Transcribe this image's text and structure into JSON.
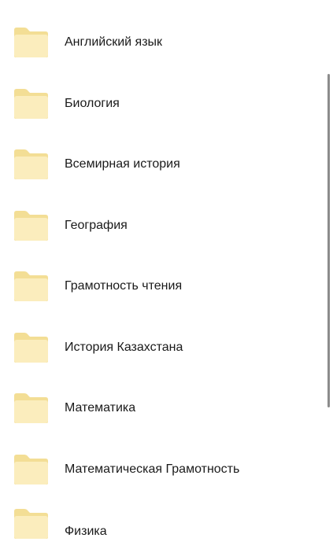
{
  "folders": [
    {
      "name": "Английский язык",
      "icon": "folder-icon"
    },
    {
      "name": "Биология",
      "icon": "folder-icon"
    },
    {
      "name": "Всемирная история",
      "icon": "folder-icon"
    },
    {
      "name": "География",
      "icon": "folder-icon"
    },
    {
      "name": "Грамотность чтения",
      "icon": "folder-icon"
    },
    {
      "name": "История Казахстана",
      "icon": "folder-icon"
    },
    {
      "name": "Математика",
      "icon": "folder-icon"
    },
    {
      "name": "Математическая Грамотность",
      "icon": "folder-icon"
    },
    {
      "name": "Физика",
      "icon": "folder-icon"
    }
  ],
  "colors": {
    "folder_back": "#f3de95",
    "folder_front": "#fbedbd",
    "text": "#1a1a1a",
    "scrollbar": "#8c8c8c"
  }
}
